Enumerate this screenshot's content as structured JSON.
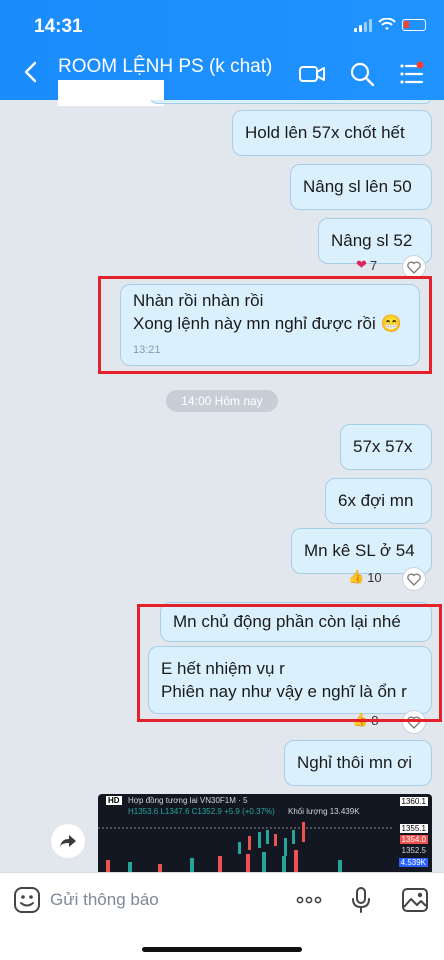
{
  "status_bar": {
    "time": "14:31"
  },
  "header": {
    "title": "ROOM LỆNH PS (k chat)",
    "icons": [
      "back-icon",
      "video-call-icon",
      "search-icon",
      "menu-list-icon"
    ]
  },
  "messages": [
    {
      "text": "Hold lên 57x chốt hết"
    },
    {
      "text": "Nâng sl lên 50"
    },
    {
      "text": "Nâng sl 52",
      "reaction_count": "7"
    },
    {
      "lines": [
        "Nhàn rồi nhàn rồi",
        "Xong lệnh này mn nghỉ được rồi 😁"
      ],
      "time": "13:21"
    },
    {
      "text": "57x 57x"
    },
    {
      "text": "6x đợi mn"
    },
    {
      "text": "Mn kê SL ở 54",
      "reaction_count": "10"
    },
    {
      "text": "Mn chủ động phần còn lại nhé"
    },
    {
      "lines": [
        "E hết nhiệm vụ r",
        "Phiên nay như vậy e nghĩ là ổn r"
      ],
      "reaction_count": "8"
    },
    {
      "text": "Nghỉ thôi mn ơi"
    }
  ],
  "date_separator": "14:00 Hôm nay",
  "shared_image": {
    "title": "Hợp đồng tương lai VN30F1M · 5",
    "badge": "HD",
    "ohlc": "H1353.6 L1347.6 C1352.9 +5.9 (+0.37%)",
    "volume_label": "Khối lượng 13.439K",
    "prices": [
      "1360.1",
      "1355.1",
      "1354.0",
      "1352.5",
      "4.539K"
    ]
  },
  "input_bar": {
    "placeholder": "Gửi thông báo"
  },
  "colors": {
    "header": "#1a8cfb",
    "bubble": "#dbf0fd",
    "highlight": "#e4202b"
  }
}
